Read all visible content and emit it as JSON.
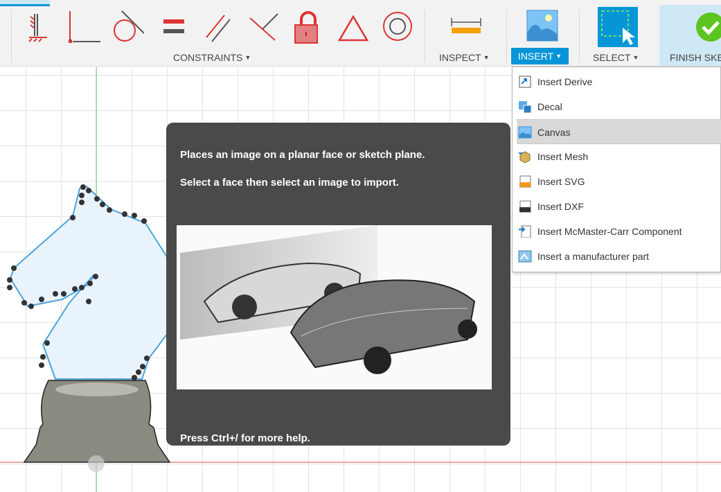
{
  "toolbar": {
    "groups": [
      {
        "label": "CONSTRAINTS"
      },
      {
        "label": "INSPECT"
      },
      {
        "label": "INSERT",
        "active": true
      },
      {
        "label": "SELECT"
      },
      {
        "label": "FINISH SKETCH"
      }
    ],
    "constraint_icons": [
      "fix-icon",
      "coincident-icon",
      "tangent-icon",
      "equal-icon",
      "parallel-icon",
      "perpendicular-icon",
      "lock-icon",
      "triangle-icon",
      "concentric-icon"
    ],
    "accent": "#0696d7"
  },
  "insert_menu": {
    "items": [
      {
        "label": "Insert Derive",
        "icon": "insert-derive-icon"
      },
      {
        "label": "Decal",
        "icon": "decal-icon"
      },
      {
        "label": "Canvas",
        "icon": "canvas-icon",
        "highlighted": true
      },
      {
        "label": "Insert Mesh",
        "icon": "insert-mesh-icon"
      },
      {
        "label": "Insert SVG",
        "icon": "insert-svg-icon"
      },
      {
        "label": "Insert DXF",
        "icon": "insert-dxf-icon"
      },
      {
        "label": "Insert McMaster-Carr Component",
        "icon": "mcmaster-icon"
      },
      {
        "label": "Insert a manufacturer part",
        "icon": "manufacturer-part-icon"
      }
    ]
  },
  "tooltip": {
    "line1": "Places an image on a planar face or sketch plane.",
    "line2": "Select a face then select an image to import.",
    "footer": "Press Ctrl+/ for more help."
  }
}
